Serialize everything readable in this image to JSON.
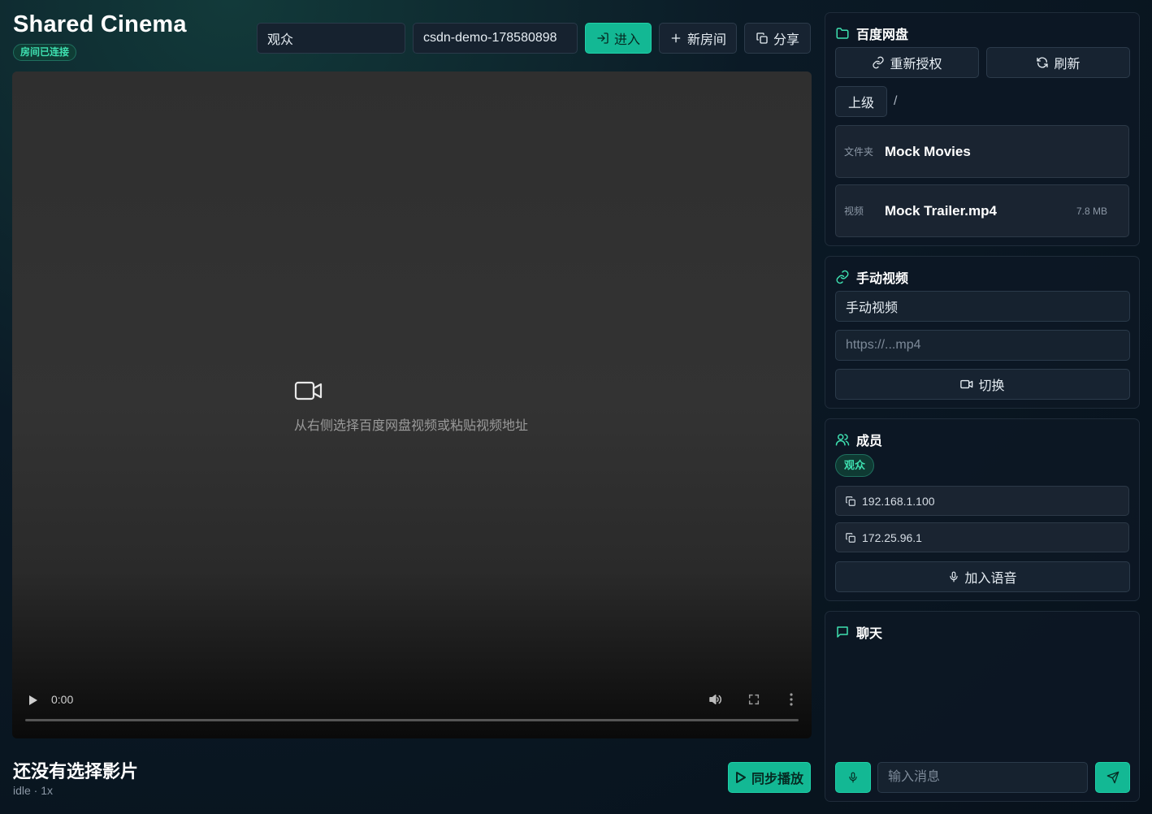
{
  "header": {
    "app_title": "Shared Cinema",
    "status_badge": "房间已连接",
    "name_input_value": "观众",
    "room_input_value": "csdn-demo-178580898",
    "enter_label": "进入",
    "new_room_label": "新房间",
    "share_label": "分享"
  },
  "player": {
    "empty_hint": "从右侧选择百度网盘视频或粘贴视频地址",
    "time": "0:00",
    "progress": 0
  },
  "now_playing": {
    "title": "还没有选择影片",
    "meta": "idle · 1x",
    "sync_label": "同步播放"
  },
  "baidu": {
    "title": "百度网盘",
    "reauth_label": "重新授权",
    "refresh_label": "刷新",
    "up_label": "上级",
    "path": "/",
    "items": [
      {
        "type": "文件夹",
        "name": "Mock Movies",
        "size": ""
      },
      {
        "type": "视频",
        "name": "Mock Trailer.mp4",
        "size": "7.8 MB"
      }
    ]
  },
  "manual": {
    "title": "手动视频",
    "name_value": "手动视频",
    "url_placeholder": "https://...mp4",
    "switch_label": "切换"
  },
  "members": {
    "title": "成员",
    "badge": "观众",
    "ips": [
      "192.168.1.100",
      "172.25.96.1"
    ],
    "voice_label": "加入语音"
  },
  "chat": {
    "title": "聊天",
    "input_placeholder": "输入消息"
  },
  "colors": {
    "accent": "#13b894",
    "accent_text": "#3ee0b0",
    "panel_border": "#1f2c3a"
  }
}
